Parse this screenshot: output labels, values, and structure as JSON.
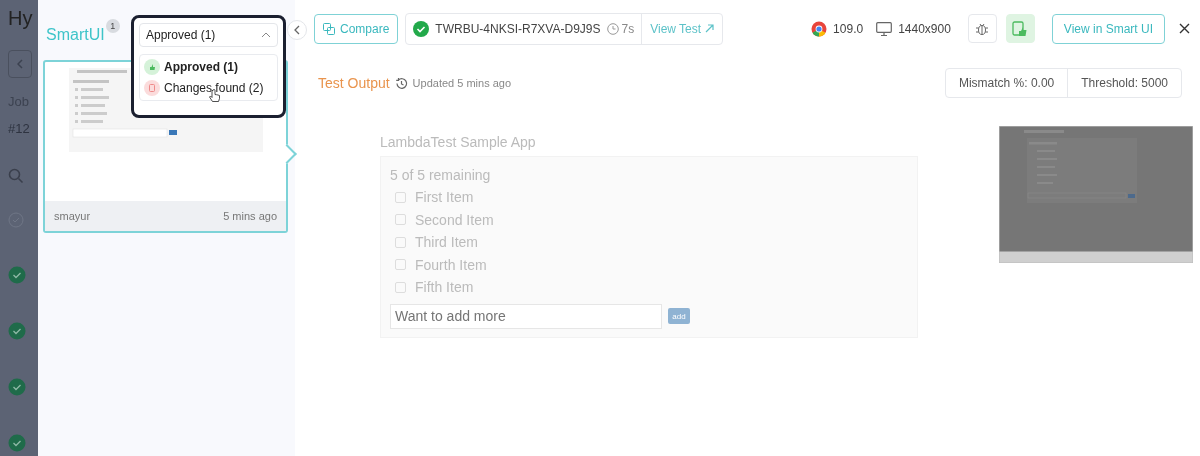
{
  "background_page": {
    "title": "Hy",
    "label": "Job",
    "job_number": "#12",
    "rows": [
      {
        "kind": "pending"
      },
      {
        "kind": "passed"
      },
      {
        "kind": "passed"
      },
      {
        "kind": "passed"
      },
      {
        "kind": "passed"
      }
    ]
  },
  "sidebar": {
    "title": "SmartUI",
    "badge": "1",
    "filter": {
      "value": "Approved  (1)",
      "expanded": true,
      "options": [
        {
          "label": "Approved (1)",
          "kind": "approved",
          "selected": true,
          "hovered": false
        },
        {
          "label": "Changes found (2)",
          "kind": "changes",
          "selected": false,
          "hovered": true
        }
      ]
    },
    "cards": [
      {
        "selected": true,
        "author": "smayur",
        "time": "5 mins ago"
      }
    ]
  },
  "toolbar": {
    "compare": "Compare",
    "test": {
      "passed": true,
      "id": "TWRBU-4NKSI-R7XVA-D9J9S",
      "duration": "7s",
      "link": "View Test"
    },
    "browser_version": "109.0",
    "resolution": "1440x900",
    "approved": true,
    "view_button": "View in Smart UI"
  },
  "output": {
    "title": "Test Output",
    "updated": "Updated 5 mins ago",
    "mismatch": "Mismatch %: 0.00",
    "threshold": "Threshold: 5000",
    "screenshot": {
      "app_title": "LambdaTest Sample App",
      "remaining": "5 of 5 remaining",
      "items": [
        {
          "label": "First Item",
          "checked": false
        },
        {
          "label": "Second Item",
          "checked": false
        },
        {
          "label": "Third Item",
          "checked": false
        },
        {
          "label": "Fourth Item",
          "checked": false
        },
        {
          "label": "Fifth Item",
          "checked": false
        }
      ],
      "placeholder": "Want to add more",
      "button": "add"
    }
  }
}
